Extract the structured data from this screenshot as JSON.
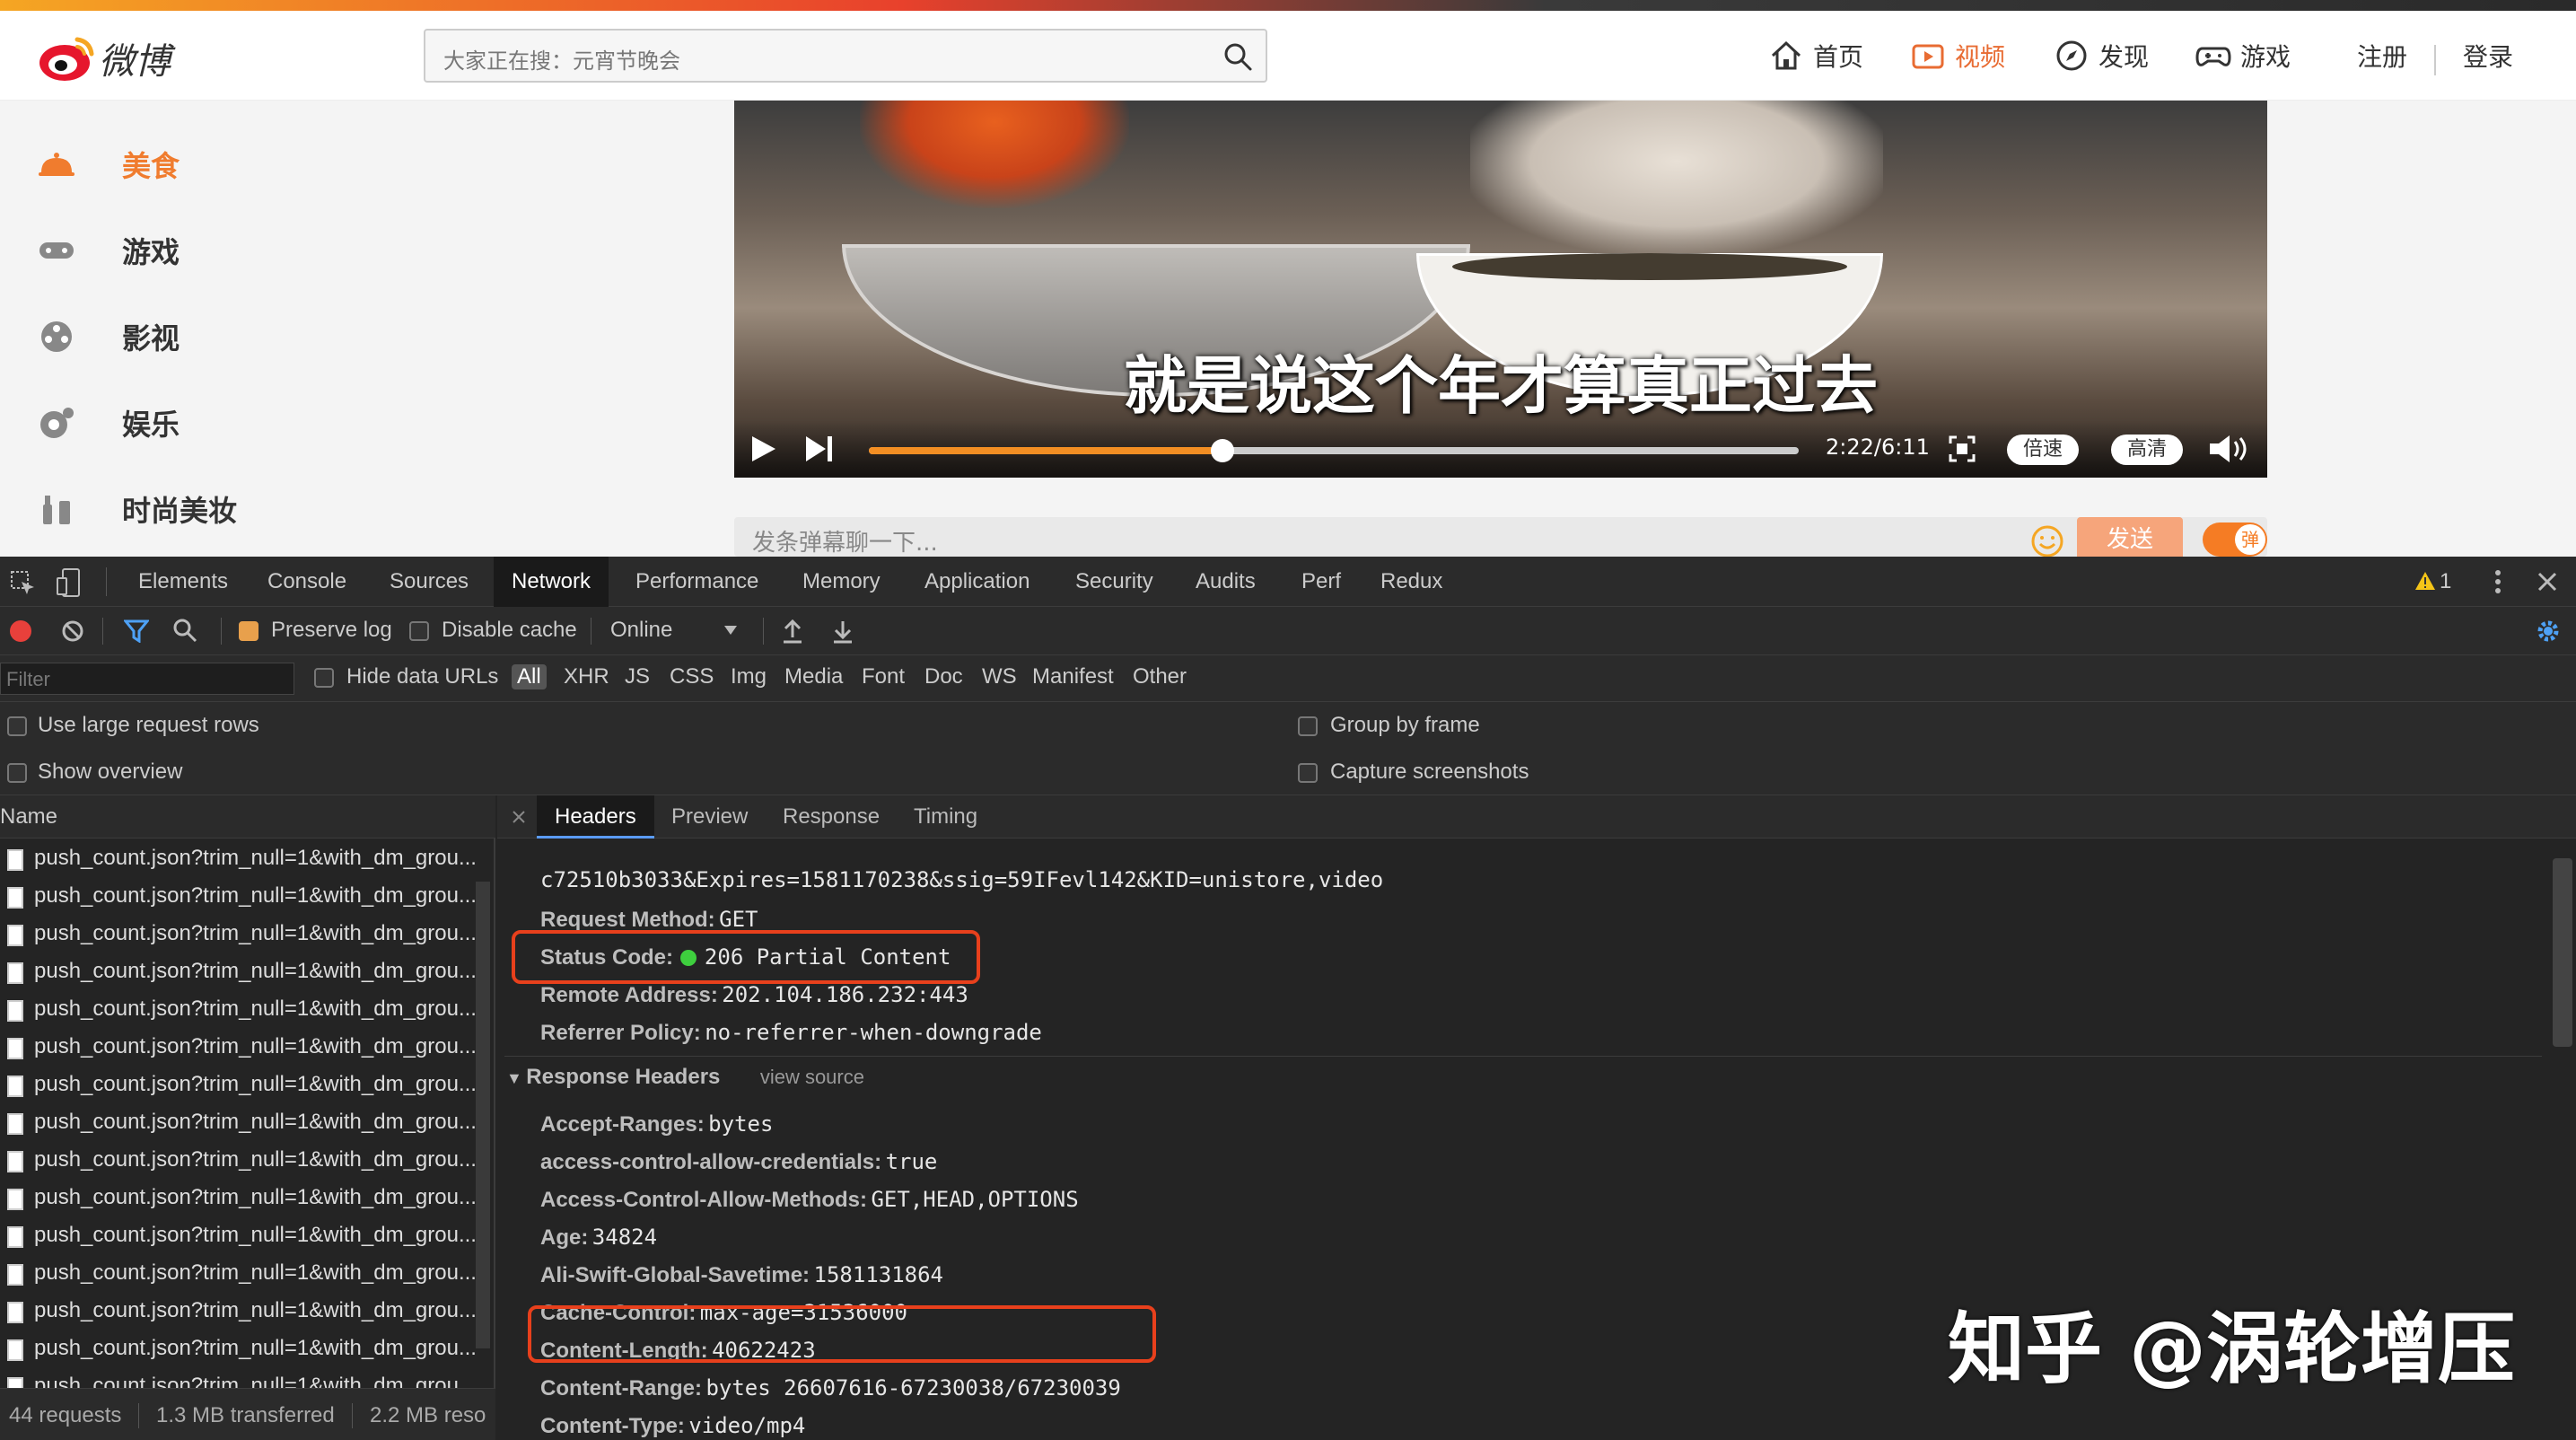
{
  "weibo": {
    "logo_text": "微博",
    "search_placeholder": "大家正在搜：元宵节晚会",
    "nav": {
      "home": "首页",
      "video": "视频",
      "discover": "发现",
      "game": "游戏",
      "register": "注册",
      "login": "登录"
    },
    "sidebar": [
      "美食",
      "游戏",
      "影视",
      "娱乐",
      "时尚美妆"
    ],
    "video": {
      "subtitle": "就是说这个年才算真正过去",
      "time": "2:22/6:11",
      "progress": 0.38,
      "speed": "倍速",
      "quality": "高清"
    },
    "danmu": {
      "placeholder": "发条弹幕聊一下...",
      "send": "发送",
      "toggle": "弹"
    }
  },
  "devtools": {
    "tabs": [
      "Elements",
      "Console",
      "Sources",
      "Network",
      "Performance",
      "Memory",
      "Application",
      "Security",
      "Audits",
      "Perf",
      "Redux"
    ],
    "active_tab": "Network",
    "warnings": "1",
    "toolbar": {
      "preserve_log": "Preserve log",
      "disable_cache": "Disable cache",
      "throttle": "Online"
    },
    "filter": {
      "placeholder": "Filter",
      "hide_data_urls": "Hide data URLs",
      "types": [
        "All",
        "XHR",
        "JS",
        "CSS",
        "Img",
        "Media",
        "Font",
        "Doc",
        "WS",
        "Manifest",
        "Other"
      ]
    },
    "options": {
      "large_rows": "Use large request rows",
      "show_overview": "Show overview",
      "group_by_frame": "Group by frame",
      "capture_screenshots": "Capture screenshots"
    },
    "list": {
      "header": "Name",
      "rows": [
        "push_count.json?trim_null=1&with_dm_grou...",
        "push_count.json?trim_null=1&with_dm_grou...",
        "push_count.json?trim_null=1&with_dm_grou...",
        "push_count.json?trim_null=1&with_dm_grou...",
        "push_count.json?trim_null=1&with_dm_grou...",
        "push_count.json?trim_null=1&with_dm_grou...",
        "push_count.json?trim_null=1&with_dm_grou...",
        "push_count.json?trim_null=1&with_dm_grou...",
        "push_count.json?trim_null=1&with_dm_grou...",
        "push_count.json?trim_null=1&with_dm_grou...",
        "push_count.json?trim_null=1&with_dm_grou...",
        "push_count.json?trim_null=1&with_dm_grou...",
        "push_count.json?trim_null=1&with_dm_grou...",
        "push_count.json?trim_null=1&with_dm_grou...",
        "push_count.json?trim_null=1&with_dm_grou...",
        "push_count.json?trim_null=1&with_dm_grou..."
      ],
      "status": {
        "requests": "44 requests",
        "transferred": "1.3 MB transferred",
        "resources": "2.2 MB reso"
      }
    },
    "detail": {
      "tabs": [
        "Headers",
        "Preview",
        "Response",
        "Timing"
      ],
      "url_tail": "c72510b3033&Expires=1581170238&ssig=59IFevl142&KID=unistore,video",
      "general": [
        {
          "k": "Request Method:",
          "v": "GET"
        },
        {
          "k": "Status Code:",
          "v": "206 Partial Content"
        },
        {
          "k": "Remote Address:",
          "v": "202.104.186.232:443"
        },
        {
          "k": "Referrer Policy:",
          "v": "no-referrer-when-downgrade"
        }
      ],
      "response_section": "Response Headers",
      "view_source": "view source",
      "response": [
        {
          "k": "Accept-Ranges:",
          "v": "bytes"
        },
        {
          "k": "access-control-allow-credentials:",
          "v": "true"
        },
        {
          "k": "Access-Control-Allow-Methods:",
          "v": "GET,HEAD,OPTIONS"
        },
        {
          "k": "Age:",
          "v": "34824"
        },
        {
          "k": "Ali-Swift-Global-Savetime:",
          "v": "1581131864"
        },
        {
          "k": "Cache-Control:",
          "v": "max-age=31536000"
        },
        {
          "k": "Content-Length:",
          "v": "40622423"
        },
        {
          "k": "Content-Range:",
          "v": "bytes 26607616-67230038/67230039"
        },
        {
          "k": "Content-Type:",
          "v": "video/mp4"
        }
      ]
    }
  },
  "watermark": "知乎 @涡轮增压",
  "colors": {
    "accent": "#f07c2e",
    "highlight_box": "#e8401c",
    "status_ok": "#3ecf3e"
  }
}
